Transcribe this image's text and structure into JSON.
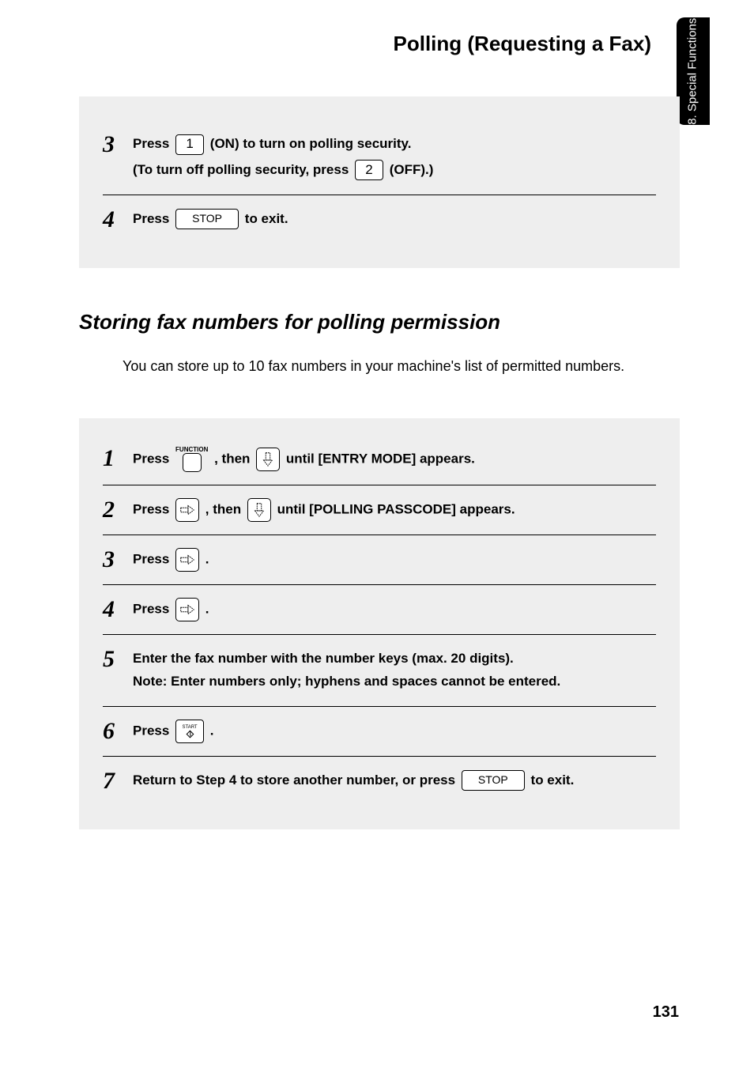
{
  "header": {
    "title": "Polling (Requesting a Fax)"
  },
  "side_tab": {
    "text": "8. Special\nFunctions"
  },
  "proc1": {
    "steps": [
      {
        "num": "3",
        "line1_parts": [
          "Press ",
          " (ON) to turn on polling security."
        ],
        "key1": "1",
        "line2_parts": [
          "(To turn off polling security, press ",
          " (OFF).)"
        ],
        "key2": "2"
      },
      {
        "num": "4",
        "parts": [
          "Press ",
          " to exit."
        ],
        "key_stop": "STOP"
      }
    ]
  },
  "section": {
    "heading": "Storing fax numbers for polling permission",
    "desc": "You can store up to 10 fax numbers in your machine's list of permitted numbers."
  },
  "proc2": {
    "function_label": "FUNCTION",
    "start_label": "START",
    "stop_label": "STOP",
    "steps": [
      {
        "num": "1",
        "t1": "Press ",
        "t2": ", then ",
        "t3": " until [ENTRY MODE] appears."
      },
      {
        "num": "2",
        "t1": "Press ",
        "t2": ", then ",
        "t3": " until [POLLING PASSCODE] appears."
      },
      {
        "num": "3",
        "t1": "Press ",
        "t2": "."
      },
      {
        "num": "4",
        "t1": "Press ",
        "t2": "."
      },
      {
        "num": "5",
        "text": "Enter the fax number with the number keys (max. 20 digits).\nNote: Enter numbers only; hyphens and spaces cannot be entered."
      },
      {
        "num": "6",
        "t1": "Press ",
        "t2": "."
      },
      {
        "num": "7",
        "t1": "Return to Step 4 to store another number, or press ",
        "t2": " to exit."
      }
    ]
  },
  "page_number": "131"
}
